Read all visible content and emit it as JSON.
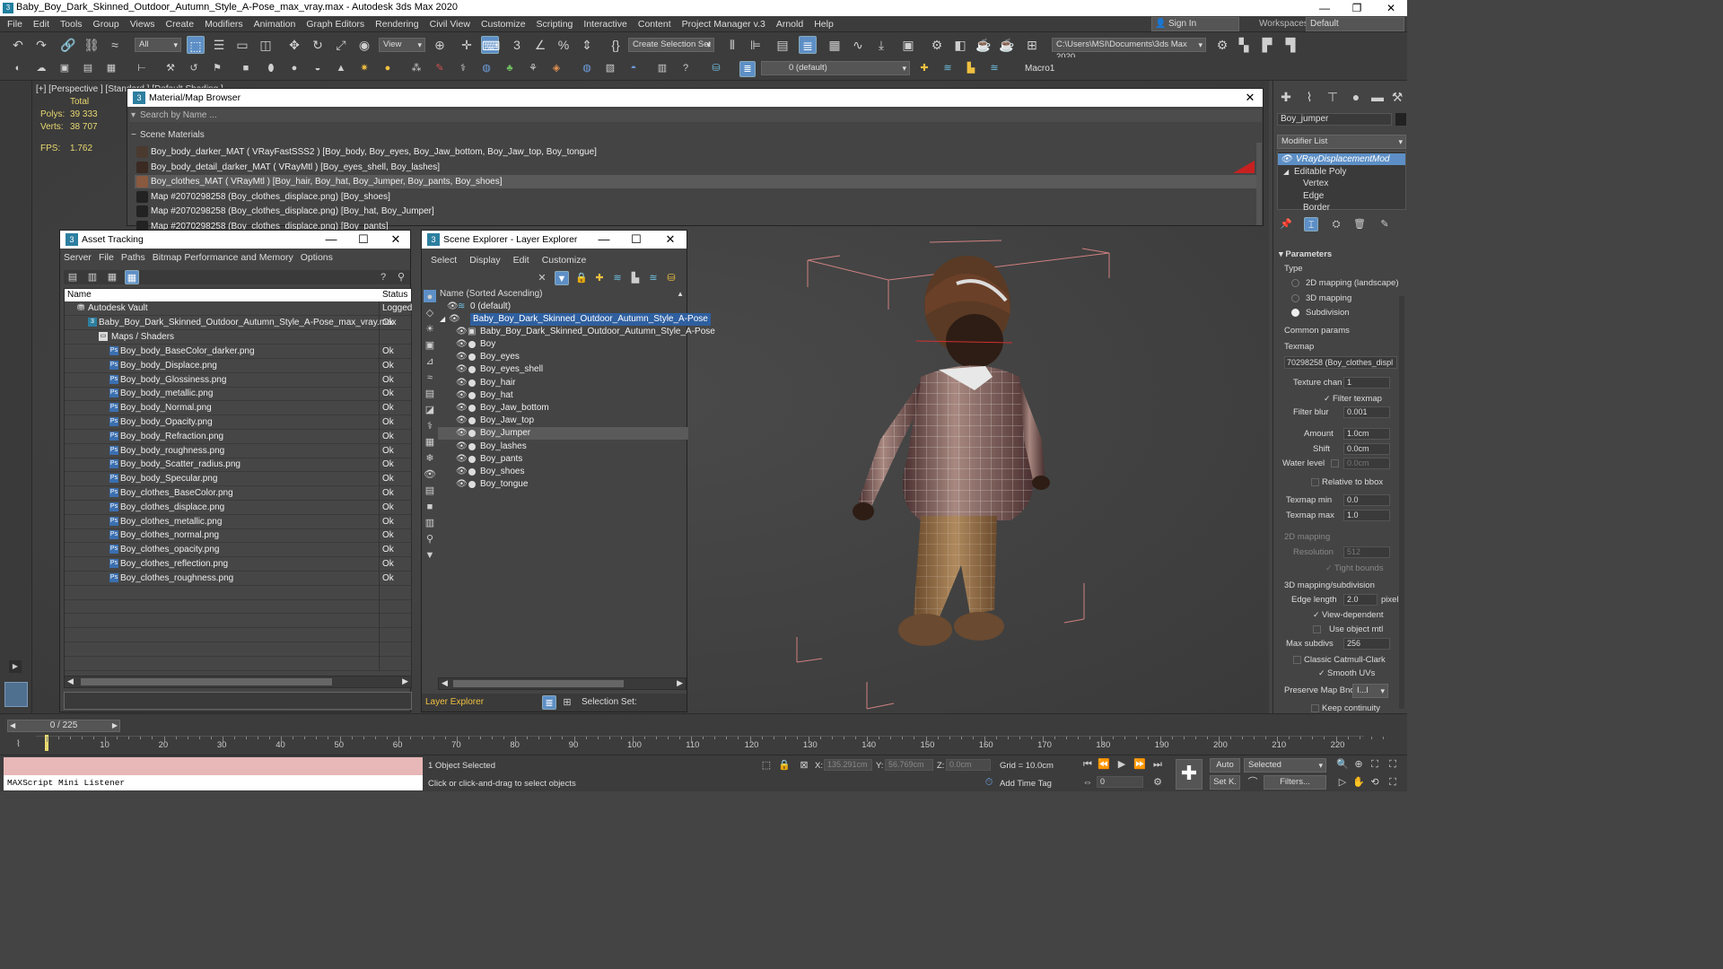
{
  "titlebar": {
    "title": "Baby_Boy_Dark_Skinned_Outdoor_Autumn_Style_A-Pose_max_vray.max - Autodesk 3ds Max 2020"
  },
  "menubar": {
    "items": [
      "File",
      "Edit",
      "Tools",
      "Group",
      "Views",
      "Create",
      "Modifiers",
      "Animation",
      "Graph Editors",
      "Rendering",
      "Civil View",
      "Customize",
      "Scripting",
      "Interactive",
      "Content",
      "Project Manager v.3",
      "Arnold",
      "Help"
    ],
    "signin": "Sign In",
    "workspaces_label": "Workspaces:",
    "workspace_value": "Default"
  },
  "toolbar": {
    "filter_value": "All",
    "refcoord_value": "View",
    "selection_set": "Create Selection Set",
    "project_path": "C:\\Users\\MSI\\Documents\\3ds Max 2020",
    "layer_value": "0 (default)",
    "macro_label": "Macro1"
  },
  "viewport": {
    "label": "[+] [Perspective ] [Standard ] [Default Shading ]",
    "total_label": "Total",
    "polys_label": "Polys:",
    "polys_value": "39 333",
    "verts_label": "Verts:",
    "verts_value": "38 707",
    "fps_label": "FPS:",
    "fps_value": "1.762"
  },
  "material_browser": {
    "title": "Material/Map Browser",
    "search_placeholder": "Search by Name ...",
    "group_label": "Scene Materials",
    "rows": [
      {
        "text": "Boy_body_darker_MAT  ( VRayFastSSS2 )  [Boy_body, Boy_eyes, Boy_Jaw_bottom, Boy_Jaw_top, Boy_tongue]",
        "swatch": "#4a3a30"
      },
      {
        "text": "Boy_body_detail_darker_MAT  ( VRayMtl )  [Boy_eyes_shell, Boy_lashes]",
        "swatch": "#3a2a22"
      },
      {
        "text": "Boy_clothes_MAT  ( VRayMtl )  [Boy_hair, Boy_hat, Boy_Jumper, Boy_pants, Boy_shoes]",
        "swatch": "#8a5a40"
      },
      {
        "text": "Map #2070298258 (Boy_clothes_displace.png)  [Boy_shoes]",
        "swatch": "#222222"
      },
      {
        "text": "Map #2070298258 (Boy_clothes_displace.png)  [Boy_hat, Boy_Jumper]",
        "swatch": "#222222"
      },
      {
        "text": "Map #2070298258 (Boy_clothes_displace.png)  [Boy_pants]",
        "swatch": "#222222"
      }
    ]
  },
  "asset_tracking": {
    "title": "Asset Tracking",
    "menu": [
      "Server",
      "File",
      "Paths",
      "Bitmap Performance and Memory",
      "Options"
    ],
    "col_name": "Name",
    "col_status": "Status",
    "vault": {
      "name": "Autodesk Vault",
      "status": "Logged"
    },
    "file": {
      "name": "Baby_Boy_Dark_Skinned_Outdoor_Autumn_Style_A-Pose_max_vray.max",
      "status": "Ok"
    },
    "folder": "Maps / Shaders",
    "maps": [
      {
        "name": "Boy_body_BaseColor_darker.png",
        "status": "Ok"
      },
      {
        "name": "Boy_body_Displace.png",
        "status": "Ok"
      },
      {
        "name": "Boy_body_Glossiness.png",
        "status": "Ok"
      },
      {
        "name": "Boy_body_metallic.png",
        "status": "Ok"
      },
      {
        "name": "Boy_body_Normal.png",
        "status": "Ok"
      },
      {
        "name": "Boy_body_Opacity.png",
        "status": "Ok"
      },
      {
        "name": "Boy_body_Refraction.png",
        "status": "Ok"
      },
      {
        "name": "Boy_body_roughness.png",
        "status": "Ok"
      },
      {
        "name": "Boy_body_Scatter_radius.png",
        "status": "Ok"
      },
      {
        "name": "Boy_body_Specular.png",
        "status": "Ok"
      },
      {
        "name": "Boy_clothes_BaseColor.png",
        "status": "Ok"
      },
      {
        "name": "Boy_clothes_displace.png",
        "status": "Ok"
      },
      {
        "name": "Boy_clothes_metallic.png",
        "status": "Ok"
      },
      {
        "name": "Boy_clothes_normal.png",
        "status": "Ok"
      },
      {
        "name": "Boy_clothes_opacity.png",
        "status": "Ok"
      },
      {
        "name": "Boy_clothes_reflection.png",
        "status": "Ok"
      },
      {
        "name": "Boy_clothes_roughness.png",
        "status": "Ok"
      }
    ]
  },
  "scene_explorer": {
    "title": "Scene Explorer - Layer Explorer",
    "menu": [
      "Select",
      "Display",
      "Edit",
      "Customize"
    ],
    "column_header": "Name (Sorted Ascending)",
    "default_layer": "0 (default)",
    "layer": "Baby_Boy_Dark_Skinned_Outdoor_Autumn_Style_A-Pose",
    "group": "Baby_Boy_Dark_Skinned_Outdoor_Autumn_Style_A-Pose",
    "objects": [
      "Boy",
      "Boy_eyes",
      "Boy_eyes_shell",
      "Boy_hair",
      "Boy_hat",
      "Boy_Jaw_bottom",
      "Boy_Jaw_top",
      "Boy_Jumper",
      "Boy_lashes",
      "Boy_pants",
      "Boy_shoes",
      "Boy_tongue"
    ],
    "selected_object": "Boy_Jumper",
    "footer_label": "Layer Explorer",
    "selection_set_label": "Selection Set:"
  },
  "command_panel": {
    "object_name": "Boy_jumper",
    "modifier_list": "Modifier List",
    "stack": [
      "VRayDisplacementMod",
      "Editable Poly",
      "Vertex",
      "Edge",
      "Border"
    ],
    "rollout": "Parameters",
    "type_label": "Type",
    "type_options": [
      "2D mapping (landscape)",
      "3D mapping",
      "Subdivision"
    ],
    "type_selected": "Subdivision",
    "common_params": "Common params",
    "texmap_label": "Texmap",
    "texmap_value": "70298258 (Boy_clothes_displ",
    "texture_chan_label": "Texture chan",
    "texture_chan_value": "1",
    "filter_texmap": "Filter texmap",
    "filter_blur_label": "Filter blur",
    "filter_blur_value": "0.001",
    "amount_label": "Amount",
    "amount_value": "1.0cm",
    "shift_label": "Shift",
    "shift_value": "0.0cm",
    "water_level_label": "Water level",
    "water_level_value": "0.0cm",
    "relative_bbox": "Relative to bbox",
    "texmap_min_label": "Texmap min",
    "texmap_min_value": "0.0",
    "texmap_max_label": "Texmap max",
    "texmap_max_value": "1.0",
    "mapping2d_label": "2D mapping",
    "resolution_label": "Resolution",
    "resolution_value": "512",
    "tight_bounds": "Tight bounds",
    "mapping3d_label": "3D mapping/subdivision",
    "edge_length_label": "Edge length",
    "edge_length_value": "2.0",
    "pixels_label": "pixels",
    "view_dependent": "View-dependent",
    "use_object_mtl": "Use object mtl",
    "max_subdivs_label": "Max subdivs",
    "max_subdivs_value": "256",
    "classic_catmull": "Classic Catmull-Clark",
    "smooth_uvs": "Smooth UVs",
    "preserve_map_label": "Preserve Map Bnd",
    "preserve_map_value": "I...l",
    "keep_continuity": "Keep continuity"
  },
  "timeline": {
    "frame_counter": "0 / 225",
    "ticks": [
      "0",
      "10",
      "20",
      "30",
      "40",
      "50",
      "60",
      "70",
      "80",
      "90",
      "100",
      "110",
      "120",
      "130",
      "140",
      "150",
      "160",
      "170",
      "180",
      "190",
      "200",
      "210",
      "220"
    ]
  },
  "statusbar": {
    "listener": "MAXScript Mini Listener",
    "objects_selected": "1 Object Selected",
    "prompt": "Click or click-and-drag to select objects",
    "x_label": "X:",
    "x_value": "135.291cm",
    "y_label": "Y:",
    "y_value": "56.769cm",
    "z_label": "Z:",
    "z_value": "0.0cm",
    "grid": "Grid = 10.0cm",
    "add_time_tag": "Add Time Tag",
    "auto_label": "Auto",
    "selected_value": "Selected",
    "setk_label": "Set K.",
    "filters_label": "Filters...",
    "frame_value": "0"
  }
}
